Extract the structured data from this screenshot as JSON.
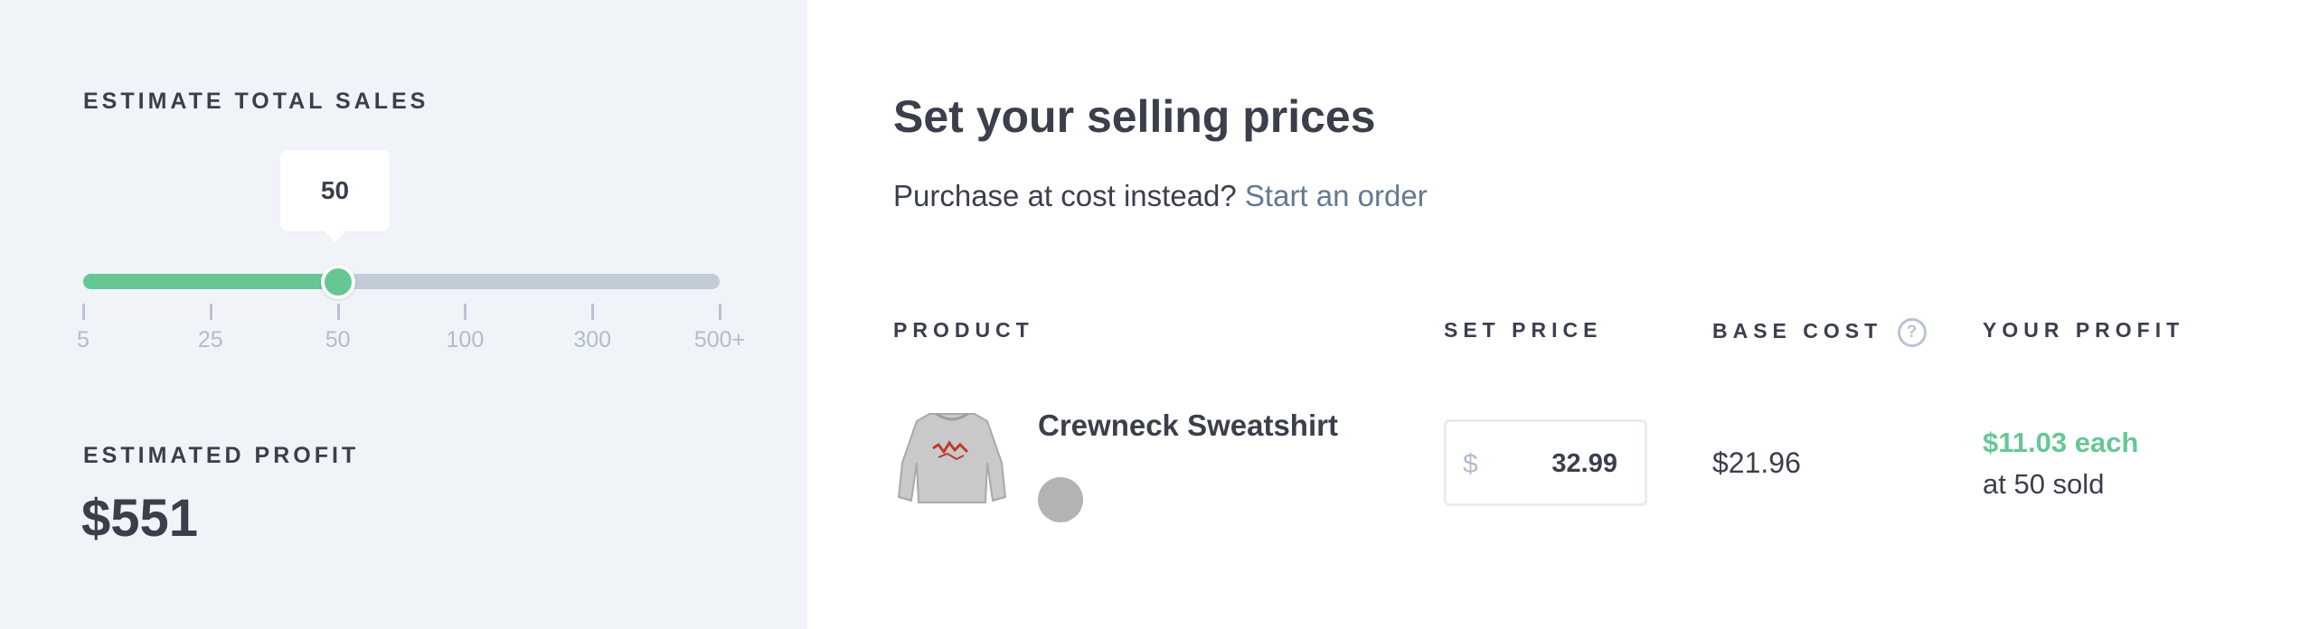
{
  "estimate": {
    "label": "ESTIMATE TOTAL SALES",
    "current_value": "50",
    "ticks": [
      "5",
      "25",
      "50",
      "100",
      "300",
      "500+"
    ],
    "selected_index": 2
  },
  "estimated_profit": {
    "label": "ESTIMATED PROFIT",
    "value": "$551"
  },
  "main": {
    "title": "Set your selling prices",
    "subtitle_text": "Purchase at cost instead?",
    "subtitle_link": "Start an order"
  },
  "table": {
    "headers": {
      "product": "PRODUCT",
      "set_price": "SET PRICE",
      "base_cost": "BASE COST",
      "base_cost_help": "?",
      "your_profit": "YOUR PROFIT"
    },
    "rows": [
      {
        "product_name": "Crewneck Sweatshirt",
        "currency": "$",
        "price": "32.99",
        "base_cost": "$21.96",
        "profit_each": "$11.03 each",
        "profit_sold": "at 50 sold"
      }
    ]
  },
  "colors": {
    "accent_green": "#66c795",
    "link": "#637892",
    "panel_bg": "#f0f3f8",
    "swatch": "#b3b3b3"
  },
  "icons": [
    "help-icon",
    "sweatshirt-thumbnail"
  ]
}
